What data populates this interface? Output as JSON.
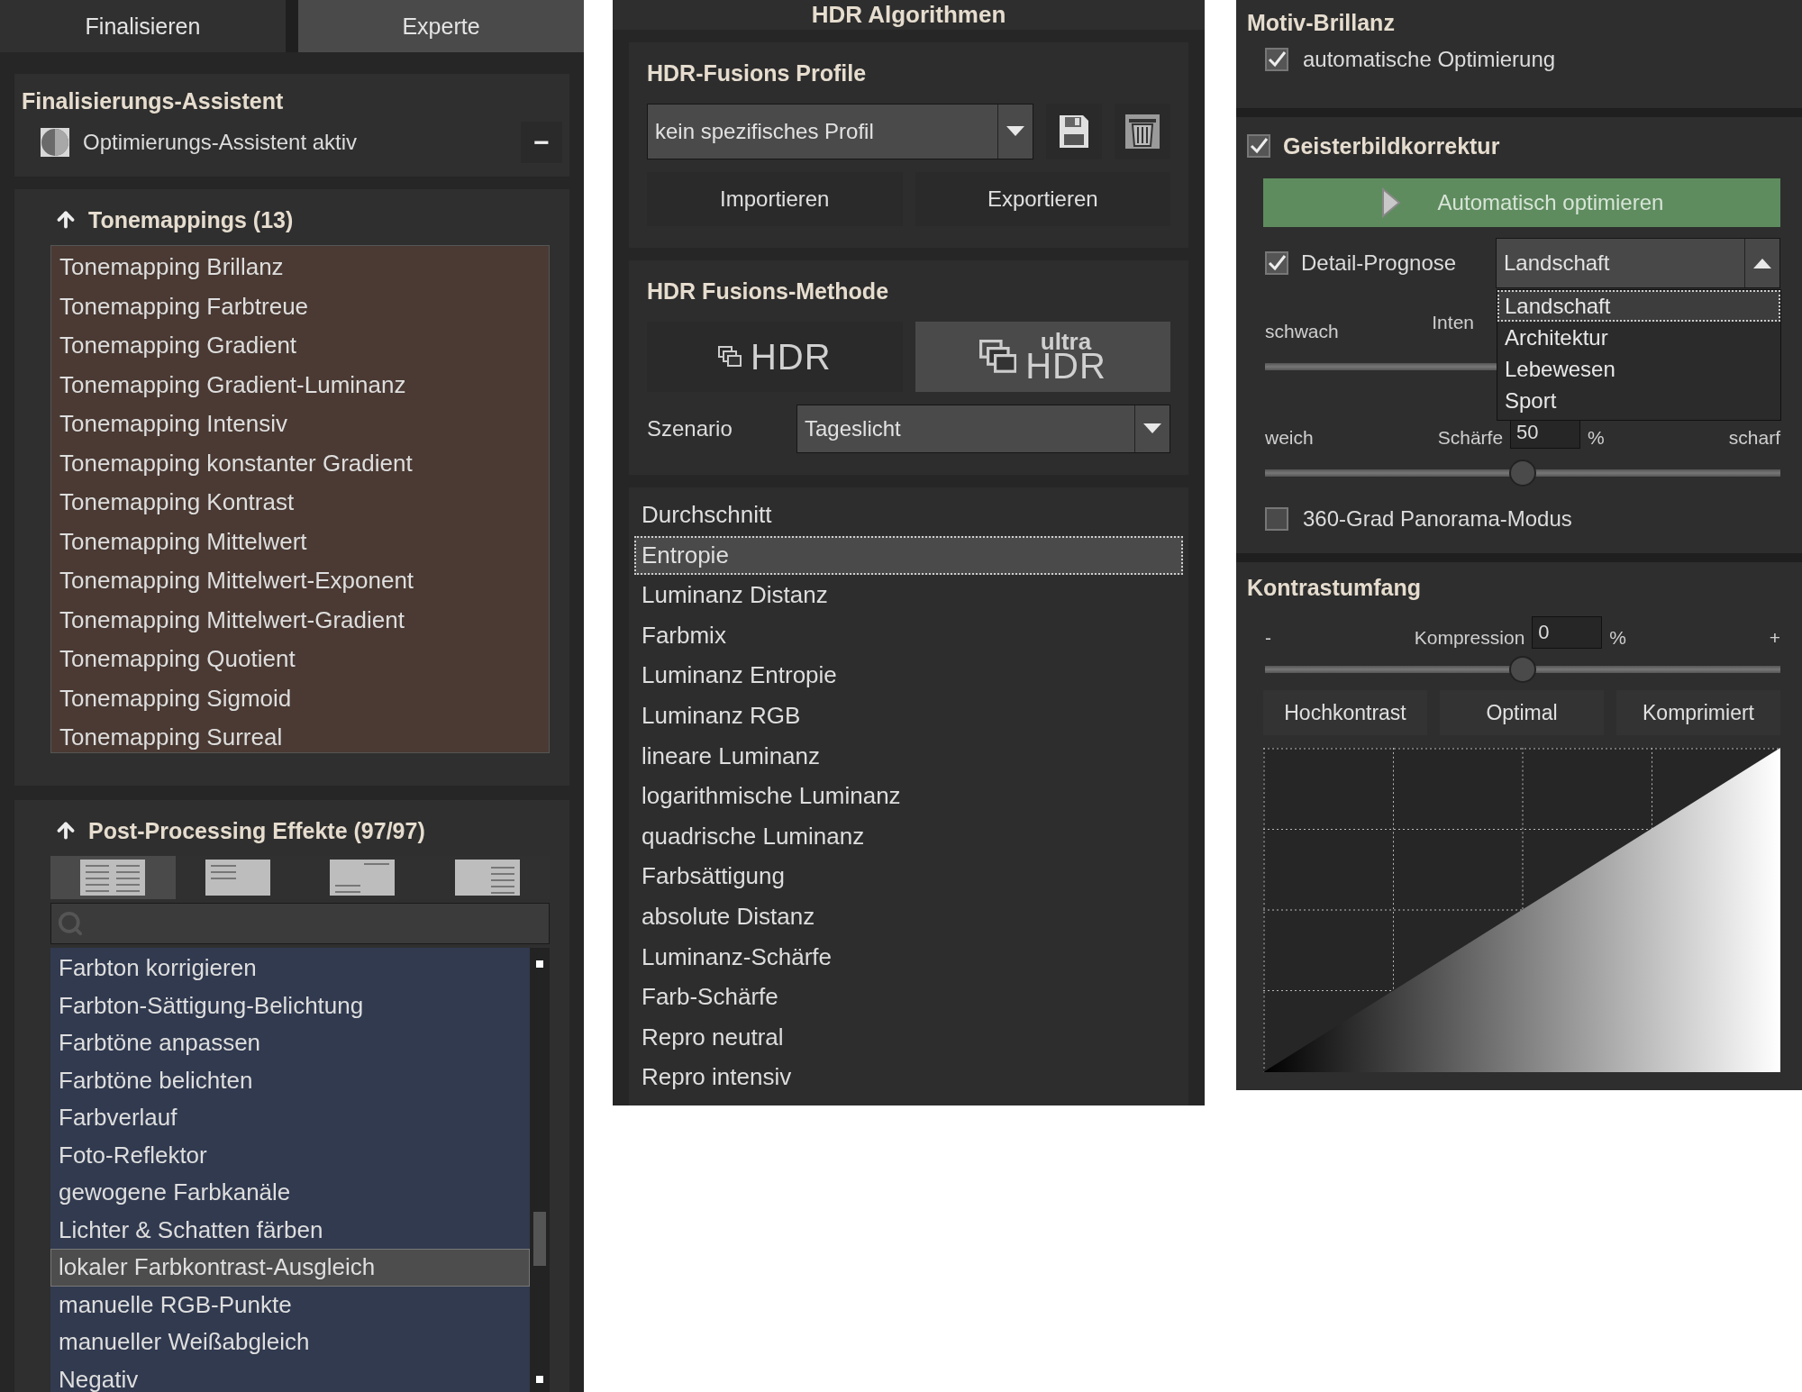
{
  "left_panel": {
    "tabs": [
      {
        "label": "Finalisieren",
        "selected": false
      },
      {
        "label": "Experte",
        "selected": true
      }
    ],
    "assistant": {
      "title": "Finalisierungs-Assistent",
      "toggle_label": "Optimierungs-Assistent aktiv",
      "collapse_button": "−"
    },
    "tonemappings": {
      "title": "Tonemappings (13)",
      "items": [
        "Tonemapping Brillanz",
        "Tonemapping Farbtreue",
        "Tonemapping Gradient",
        "Tonemapping Gradient-Luminanz",
        "Tonemapping Intensiv",
        "Tonemapping konstanter Gradient",
        "Tonemapping Kontrast",
        "Tonemapping Mittelwert",
        "Tonemapping Mittelwert-Exponent",
        "Tonemapping Mittelwert-Gradient",
        "Tonemapping Quotient",
        "Tonemapping Sigmoid",
        "Tonemapping Surreal"
      ]
    },
    "post_processing": {
      "title": "Post-Processing Effekte (97/97)",
      "view_modes": [
        {
          "kind": "two-columns",
          "selected": true
        },
        {
          "kind": "top-left",
          "selected": false
        },
        {
          "kind": "split",
          "selected": false
        },
        {
          "kind": "right",
          "selected": false
        }
      ],
      "items": [
        {
          "label": "Farbton korrigieren",
          "selected": false
        },
        {
          "label": "Farbton-Sättigung-Belichtung",
          "selected": false
        },
        {
          "label": "Farbtöne anpassen",
          "selected": false
        },
        {
          "label": "Farbtöne belichten",
          "selected": false
        },
        {
          "label": "Farbverlauf",
          "selected": false
        },
        {
          "label": "Foto-Reflektor",
          "selected": false
        },
        {
          "label": "gewogene Farbkanäle",
          "selected": false
        },
        {
          "label": "Lichter & Schatten färben",
          "selected": false
        },
        {
          "label": "lokaler Farbkontrast-Ausgleich",
          "selected": true
        },
        {
          "label": "manuelle RGB-Punkte",
          "selected": false
        },
        {
          "label": "manueller Weißabgleich",
          "selected": false
        },
        {
          "label": "Negativ",
          "selected": false
        }
      ]
    }
  },
  "middle_panel": {
    "title": "HDR Algorithmen",
    "profiles": {
      "title": "HDR-Fusions Profile",
      "profile_select": "kein spezifisches Profil",
      "buttons": [
        "Importieren",
        "Exportieren"
      ]
    },
    "method": {
      "title": "HDR Fusions-Methode",
      "modes": [
        {
          "label": "HDR",
          "selected": false
        },
        {
          "label_top": "ultra",
          "label": "HDR",
          "selected": true
        }
      ],
      "scenario_label": "Szenario",
      "scenario_select": "Tageslicht"
    },
    "algorithms": [
      {
        "label": "Durchschnitt",
        "selected": false
      },
      {
        "label": "Entropie",
        "selected": true
      },
      {
        "label": "Luminanz Distanz",
        "selected": false
      },
      {
        "label": "Farbmix",
        "selected": false
      },
      {
        "label": "Luminanz Entropie",
        "selected": false
      },
      {
        "label": "Luminanz RGB",
        "selected": false
      },
      {
        "label": "lineare Luminanz",
        "selected": false
      },
      {
        "label": "logarithmische Luminanz",
        "selected": false
      },
      {
        "label": "quadrische Luminanz",
        "selected": false
      },
      {
        "label": "Farbsättigung",
        "selected": false
      },
      {
        "label": "absolute Distanz",
        "selected": false
      },
      {
        "label": "Luminanz-Schärfe",
        "selected": false
      },
      {
        "label": "Farb-Schärfe",
        "selected": false
      },
      {
        "label": "Repro neutral",
        "selected": false
      },
      {
        "label": "Repro intensiv",
        "selected": false
      }
    ]
  },
  "right_panel": {
    "motiv": {
      "title": "Motiv-Brillanz",
      "auto_optimize": {
        "label": "automatische Optimierung",
        "checked": true
      }
    },
    "ghost": {
      "title": "Geisterbildkorrektur",
      "checked": true,
      "auto_button": "Automatisch optimieren",
      "detail": {
        "label": "Detail-Prognose",
        "checked": true,
        "select": "Landschaft",
        "options": [
          {
            "label": "Landschaft",
            "selected": true
          },
          {
            "label": "Architektur",
            "selected": false
          },
          {
            "label": "Lebewesen",
            "selected": false
          },
          {
            "label": "Sport",
            "selected": false
          }
        ]
      },
      "intensity": {
        "min_label": "schwach",
        "label": "Inten"
      },
      "sharpness": {
        "min_label": "weich",
        "label": "Schärfe",
        "value": "50",
        "unit": "%",
        "max_label": "scharf",
        "level": 0.5
      },
      "panorama": {
        "label": "360-Grad Panorama-Modus",
        "checked": false
      }
    },
    "contrast": {
      "title": "Kontrastumfang",
      "min_label": "-",
      "label": "Kompression",
      "value": "0",
      "unit": "%",
      "max_label": "+",
      "level": 0.5,
      "presets": [
        "Hochkontrast",
        "Optimal",
        "Komprimiert"
      ]
    }
  }
}
